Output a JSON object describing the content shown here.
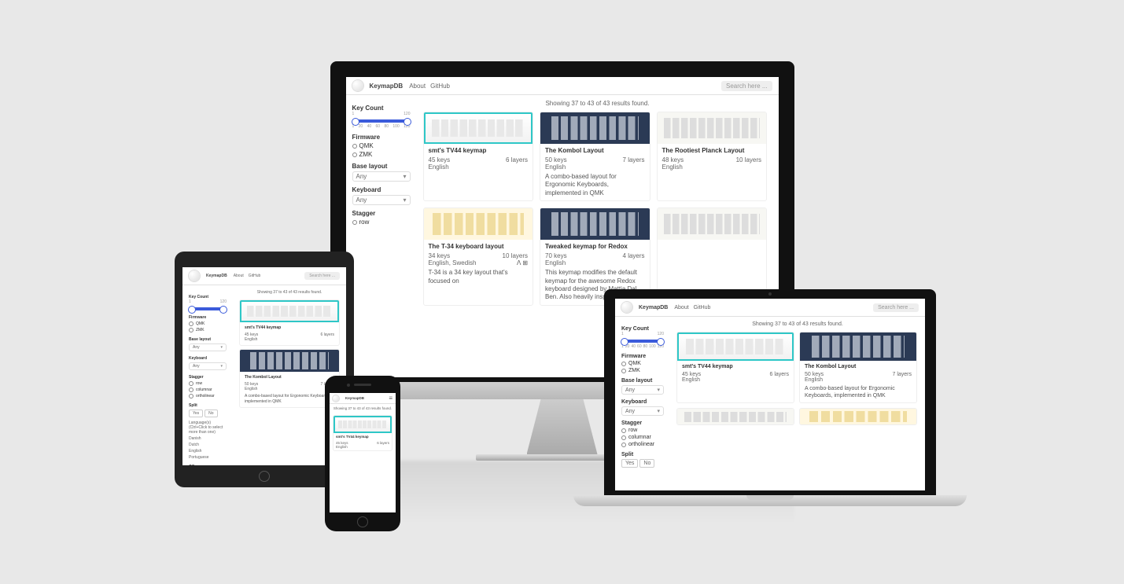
{
  "brand": "KeymapDB",
  "nav": {
    "about": "About",
    "github": "GitHub"
  },
  "search": {
    "placeholder": "Search here ..."
  },
  "results": "Showing 37 to 43 of 43 results found.",
  "sidebar": {
    "key_count_label": "Key Count",
    "range_min": "1",
    "range_max": "120",
    "ticks": [
      "1",
      "20",
      "40",
      "60",
      "80",
      "100",
      "120"
    ],
    "firmware_label": "Firmware",
    "firmware": [
      "QMK",
      "ZMK"
    ],
    "base_layout_label": "Base layout",
    "base_layout_value": "Any",
    "keyboard_label": "Keyboard",
    "keyboard_value": "Any",
    "stagger_label": "Stagger",
    "stagger": [
      "row",
      "columnar",
      "ortholinear"
    ],
    "split_label": "Split",
    "split": [
      "Yes",
      "No"
    ],
    "languages_label": "Language(s) (Ctrl+Click to select more than one)",
    "languages": [
      "Danish",
      "Dutch",
      "English",
      "Portuguese"
    ],
    "os_label": "OS"
  },
  "cards": [
    {
      "title": "smt's TV44 keymap",
      "keys": "45 keys",
      "layers": "6 layers",
      "lang": "English",
      "thumb": "t-cyan",
      "apple": true
    },
    {
      "title": "The Kombol Layout",
      "keys": "50 keys",
      "layers": "7 layers",
      "lang": "English",
      "thumb": "t-navy",
      "desc": "A combo-based layout for Ergonomic Keyboards, implemented in QMK"
    },
    {
      "title": "The Rootiest Planck Layout",
      "keys": "48 keys",
      "layers": "10 layers",
      "lang": "English",
      "thumb": "t-light"
    },
    {
      "title": "The T-34 keyboard layout",
      "keys": "34 keys",
      "layers": "10 layers",
      "lang": "English, Swedish",
      "thumb": "t-cream",
      "pair": true,
      "desc": "T-34 is a 34 key layout that's focused on"
    },
    {
      "title": "Tweaked keymap for Redox",
      "keys": "70 keys",
      "layers": "4 layers",
      "lang": "English",
      "thumb": "t-navy",
      "desc": "This keymap modifies the default keymap for the awesome Redox keyboard designed by Mattia Dal Ben. Also heavily inspired by"
    }
  ]
}
